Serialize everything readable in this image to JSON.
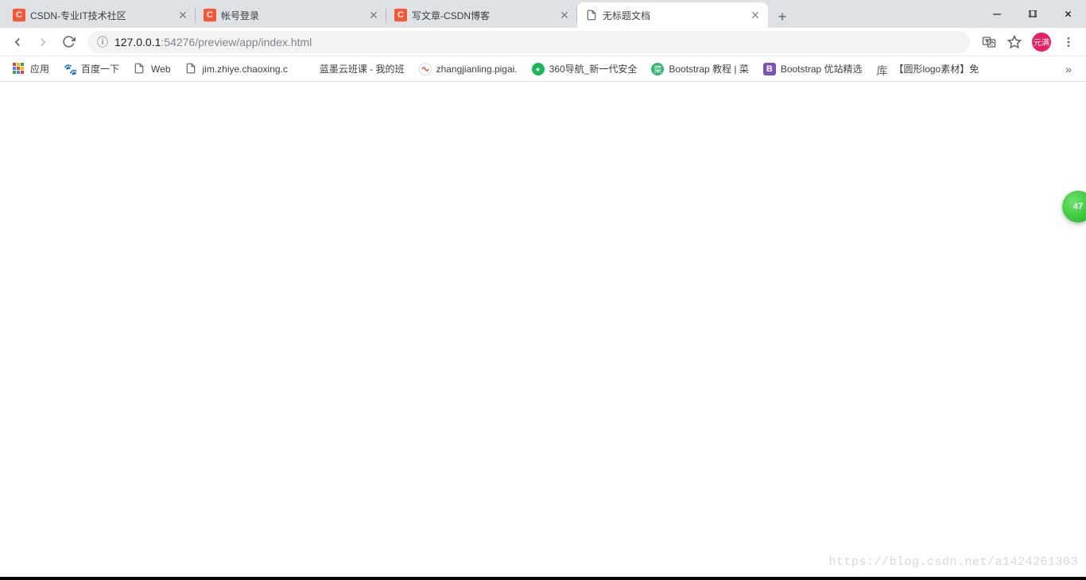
{
  "tabs": [
    {
      "title": "CSDN-专业IT技术社区",
      "favicon": "csdn",
      "active": false
    },
    {
      "title": "帐号登录",
      "favicon": "csdn",
      "active": false
    },
    {
      "title": "写文章-CSDN博客",
      "favicon": "csdn",
      "active": false
    },
    {
      "title": "无标题文档",
      "favicon": "page",
      "active": true
    }
  ],
  "address": {
    "info_icon": "ⓘ",
    "host": "127.0.0.1",
    "rest": ":54276/preview/app/index.html"
  },
  "profile_label": "元满",
  "bookmarks": [
    {
      "label": "应用",
      "icon": "apps"
    },
    {
      "label": "百度一下",
      "icon": "baidu"
    },
    {
      "label": "Web",
      "icon": "page"
    },
    {
      "label": "jim.zhiye.chaoxing.c",
      "icon": "page"
    },
    {
      "label": "蓝墨云班课 - 我的班",
      "icon": "green"
    },
    {
      "label": "zhangjianling.pigai.",
      "icon": "pigai"
    },
    {
      "label": "360导航_新一代安全",
      "icon": "360"
    },
    {
      "label": "Bootstrap 教程 | 菜",
      "icon": "green2"
    },
    {
      "label": "Bootstrap 优站精选",
      "icon": "boot"
    },
    {
      "label": "【圆形logo素材】免",
      "icon": "ku"
    }
  ],
  "floating_badge": "47",
  "watermark": "https://blog.csdn.net/a1424261303"
}
